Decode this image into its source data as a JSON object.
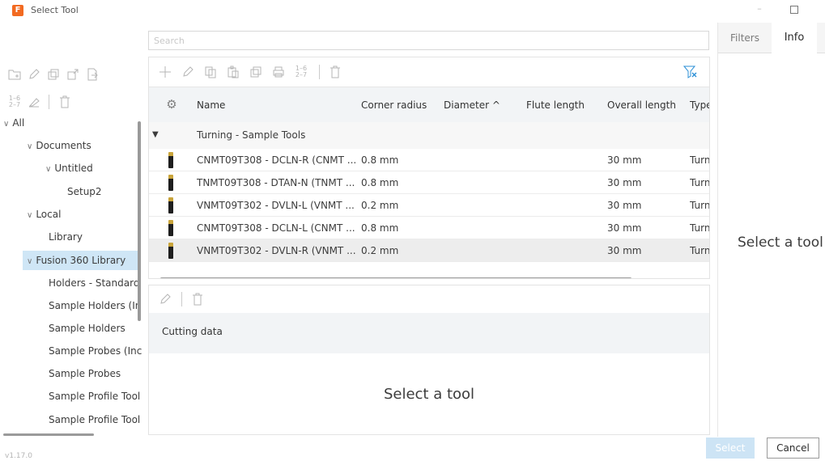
{
  "window": {
    "title": "Select Tool",
    "logo_letter": "F"
  },
  "search": {
    "placeholder": "Search",
    "value": ""
  },
  "left_toolbar": {
    "row1_icons": [
      "new-folder-icon",
      "rename-icon",
      "duplicate-icon",
      "export-icon",
      "import-icon"
    ],
    "row2_icons": [
      "renumber-icon",
      "post-process-icon",
      "delete-icon"
    ]
  },
  "tree": {
    "items": [
      {
        "label": "All",
        "chev": "∨",
        "level": 0
      },
      {
        "label": "Documents",
        "chev": "∨",
        "level": 1
      },
      {
        "label": "Untitled",
        "chev": "∨",
        "level": 2
      },
      {
        "label": "Setup2",
        "chev": "",
        "level": 3
      },
      {
        "label": "Local",
        "chev": "∨",
        "level": 1
      },
      {
        "label": "Library",
        "chev": "",
        "level": 2
      },
      {
        "label": "Fusion 360 Library",
        "chev": "∨",
        "level": 1,
        "selected": true
      },
      {
        "label": "Holders - Standard",
        "chev": "",
        "level": 2
      },
      {
        "label": "Sample Holders (In",
        "chev": "",
        "level": 2
      },
      {
        "label": "Sample Holders",
        "chev": "",
        "level": 2
      },
      {
        "label": "Sample Probes (Inc",
        "chev": "",
        "level": 2
      },
      {
        "label": "Sample Probes",
        "chev": "",
        "level": 2
      },
      {
        "label": "Sample Profile Tool",
        "chev": "",
        "level": 2
      },
      {
        "label": "Sample Profile Tool",
        "chev": "",
        "level": 2
      }
    ]
  },
  "table": {
    "toolbar_icons": [
      "add-icon",
      "edit-icon",
      "copy-icon",
      "paste-icon",
      "duplicate-icon",
      "print-icon",
      "renumber-icon",
      "delete-icon"
    ],
    "filter_icon": "clear-filter-icon",
    "columns": [
      {
        "label": "Name"
      },
      {
        "label": "Corner radius"
      },
      {
        "label": "Diameter ^"
      },
      {
        "label": "Flute length"
      },
      {
        "label": "Overall length"
      },
      {
        "label": "Type"
      }
    ],
    "group": {
      "label": "Turning - Sample Tools",
      "expanded": true
    },
    "rows": [
      {
        "name": "CNMT09T308 - DCLN-R (CNMT ...",
        "corner_radius": "0.8 mm",
        "diameter": "",
        "flute_length": "",
        "overall_length": "30 mm",
        "type": "Turn"
      },
      {
        "name": "TNMT09T308 - DTAN-N (TNMT ...",
        "corner_radius": "0.8 mm",
        "diameter": "",
        "flute_length": "",
        "overall_length": "30 mm",
        "type": "Turn"
      },
      {
        "name": "VNMT09T302 - DVLN-L (VNMT ...",
        "corner_radius": "0.2 mm",
        "diameter": "",
        "flute_length": "",
        "overall_length": "30 mm",
        "type": "Turn"
      },
      {
        "name": "CNMT09T308 - DCLN-L (CNMT ...",
        "corner_radius": "0.8 mm",
        "diameter": "",
        "flute_length": "",
        "overall_length": "30 mm",
        "type": "Turn"
      },
      {
        "name": "VNMT09T302 - DVLN-R (VNMT ...",
        "corner_radius": "0.2 mm",
        "diameter": "",
        "flute_length": "",
        "overall_length": "30 mm",
        "type": "Turn",
        "highlighted": true
      }
    ]
  },
  "cutting": {
    "toolbar_icons": [
      "edit-icon",
      "delete-icon"
    ],
    "title": "Cutting data",
    "empty_text": "Select a tool"
  },
  "right_panel": {
    "tabs": [
      {
        "label": "Filters"
      },
      {
        "label": "Info",
        "active": true
      }
    ],
    "empty_text": "Select a tool"
  },
  "footer": {
    "version": "v1.17.0",
    "select_label": "Select",
    "cancel_label": "Cancel"
  },
  "colors": {
    "accent": "#cfe6f6",
    "select_button": "#cde4f5",
    "logo": "#f26a21"
  }
}
